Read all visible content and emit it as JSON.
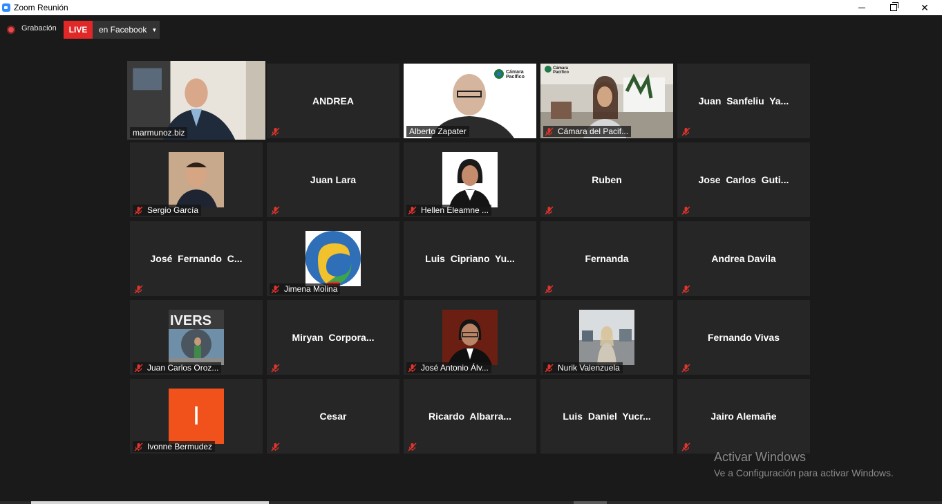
{
  "window": {
    "title": "Zoom Reunión",
    "controls": [
      "minimize",
      "restore",
      "close"
    ]
  },
  "recording": {
    "label": "Grabación",
    "live_badge": "LIVE",
    "destination": "en Facebook",
    "live_color": "#e02828"
  },
  "participants": [
    {
      "name": "marmunoz.biz",
      "video": "on",
      "muted": false,
      "active_speaker": true
    },
    {
      "name": "ANDREA",
      "video": "off",
      "muted": true
    },
    {
      "name": "Alberto Zapater",
      "video": "on",
      "muted": false,
      "logo": "Cámara del Pacífico"
    },
    {
      "name": "Cámara del Pacif...",
      "video": "on",
      "muted": true,
      "logo": "Cámara del Pacífico"
    },
    {
      "name": "Juan  Sanfeliu  Ya...",
      "video": "off",
      "muted": true
    },
    {
      "name": "Sergio García",
      "video": "photo",
      "muted": true
    },
    {
      "name": "Juan Lara",
      "video": "off",
      "muted": true
    },
    {
      "name": "Hellen Eleamne ...",
      "video": "photo",
      "muted": true
    },
    {
      "name": "Ruben",
      "video": "off",
      "muted": true
    },
    {
      "name": "Jose  Carlos  Guti...",
      "video": "off",
      "muted": true
    },
    {
      "name": "José  Fernando  C...",
      "video": "off",
      "muted": true
    },
    {
      "name": "Jimena Molina",
      "video": "photo",
      "muted": true
    },
    {
      "name": "Luis  Cipriano  Yu...",
      "video": "off",
      "muted": false
    },
    {
      "name": "Fernanda",
      "video": "off",
      "muted": true
    },
    {
      "name": "Andrea Davila",
      "video": "off",
      "muted": true
    },
    {
      "name": "Juan Carlos Oroz...",
      "video": "photo",
      "muted": true,
      "photo_text": "IVERS"
    },
    {
      "name": "Miryan  Corpora...",
      "video": "off",
      "muted": true
    },
    {
      "name": "José Antonio Álv...",
      "video": "photo",
      "muted": true
    },
    {
      "name": "Nurik Valenzuela",
      "video": "photo",
      "muted": true
    },
    {
      "name": "Fernando Vivas",
      "video": "off",
      "muted": true
    },
    {
      "name": "Ivonne Bermudez",
      "video": "photo",
      "muted": true,
      "initial": "I"
    },
    {
      "name": "Cesar",
      "video": "off",
      "muted": true
    },
    {
      "name": "Ricardo  Albarra...",
      "video": "off",
      "muted": true
    },
    {
      "name": "Luis  Daniel  Yucr...",
      "video": "off",
      "muted": false
    },
    {
      "name": "Jairo Alemañe",
      "video": "off",
      "muted": true
    }
  ],
  "watermark": {
    "title": "Activar Windows",
    "subtitle": "Ve a Configuración para activar Windows."
  },
  "colors": {
    "active_speaker_border": "#c6e85f",
    "tile_background": "#262626",
    "mute_icon": "#e0342c"
  },
  "icons": {
    "mute": "mic-muted-icon",
    "recording": "record-icon",
    "app": "zoom-icon"
  }
}
